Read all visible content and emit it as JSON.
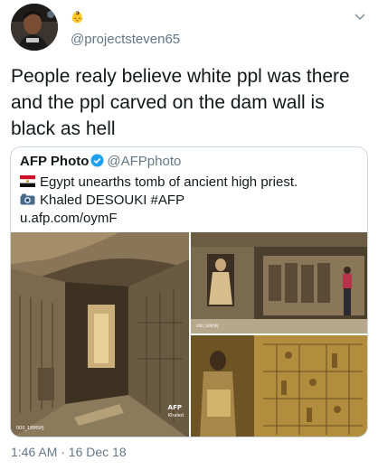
{
  "tweet": {
    "handle": "@projectsteven65",
    "text": "People realy believe white ppl was there and the ppl carved on the dam wall is black as hell",
    "timestamp": "1:46 AM · 16 Dec 18"
  },
  "quoted": {
    "name": "AFP Photo",
    "handle": "@AFPphoto",
    "line1": "Egypt unearths tomb of ancient high priest.",
    "line2": "Khaled DESOUKI #AFP",
    "line3": "u.afp.com/oymF",
    "photo1_caption": "000_1BM5PJ",
    "watermark": "AFP",
    "watermark_sub": "Khaled"
  },
  "icons": {
    "header_badge": "👶",
    "flag": "egypt-flag-icon",
    "camera": "camera-icon",
    "chevron": "chevron-down-icon",
    "verified": "verified-badge-icon"
  },
  "colors": {
    "secondary_text": "#657786",
    "border": "#ccd6dd",
    "verified": "#1da1f2"
  }
}
